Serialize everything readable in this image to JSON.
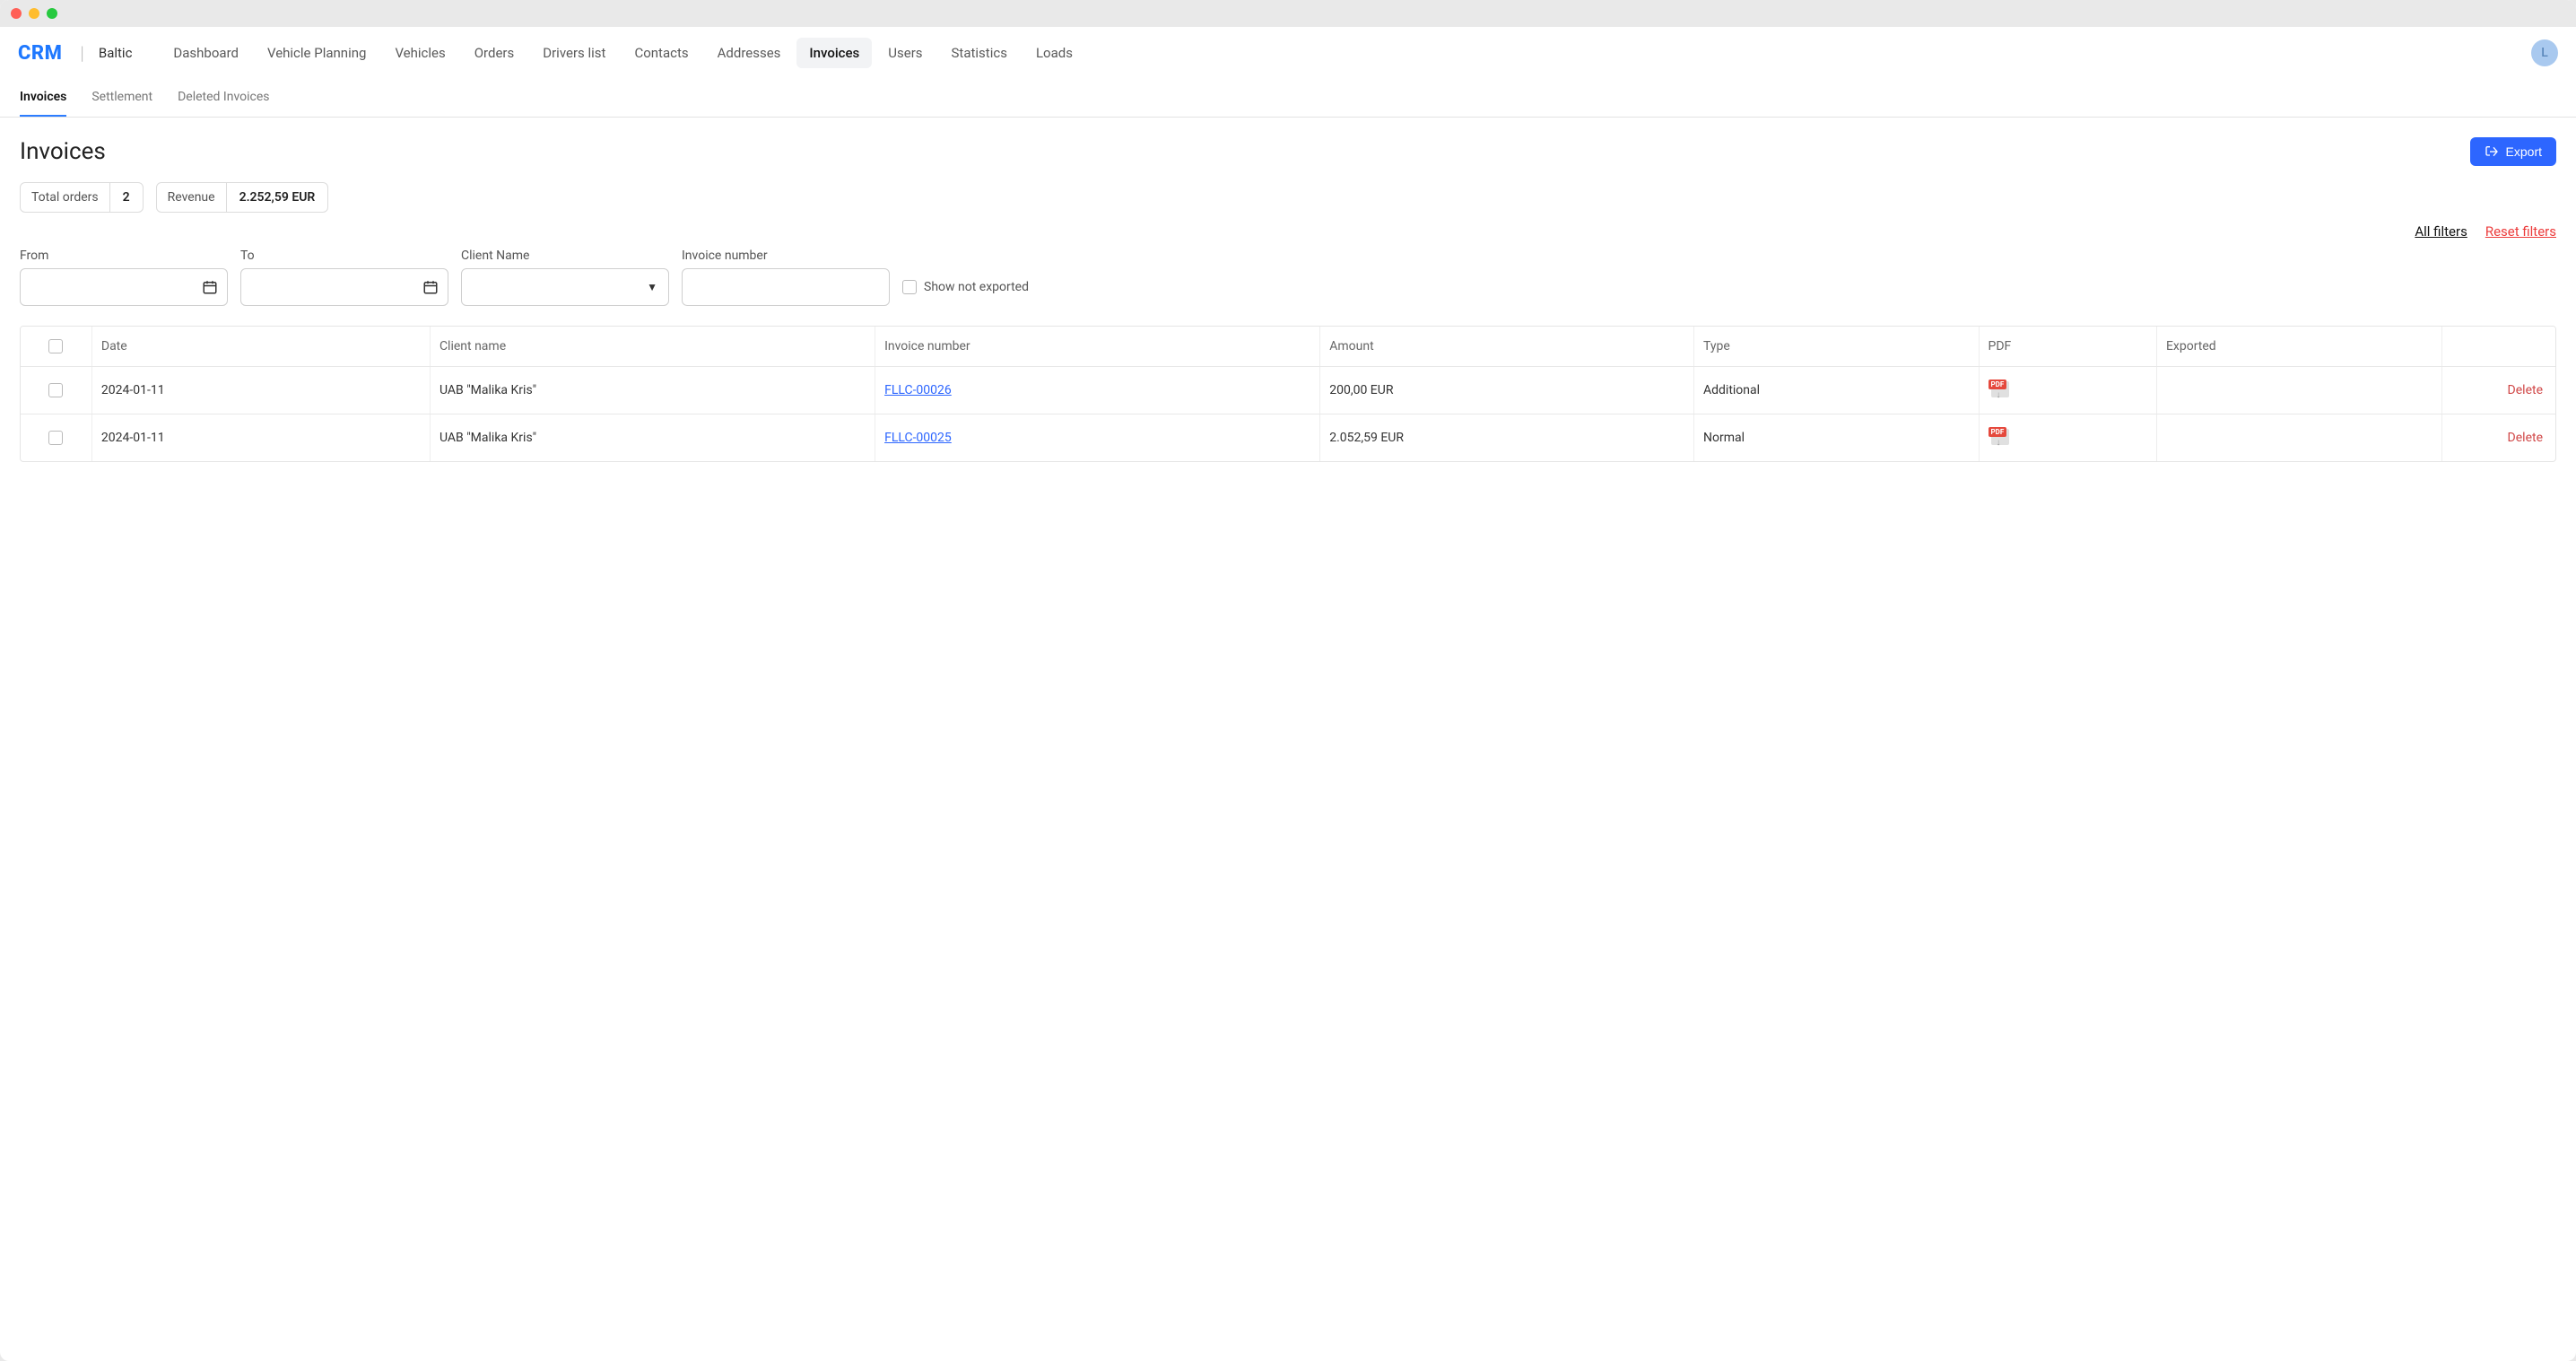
{
  "brand": {
    "logo": "CRM",
    "sub": "Baltic"
  },
  "nav": [
    {
      "label": "Dashboard"
    },
    {
      "label": "Vehicle Planning"
    },
    {
      "label": "Vehicles"
    },
    {
      "label": "Orders"
    },
    {
      "label": "Drivers list"
    },
    {
      "label": "Contacts"
    },
    {
      "label": "Addresses"
    },
    {
      "label": "Invoices",
      "active": true
    },
    {
      "label": "Users"
    },
    {
      "label": "Statistics"
    },
    {
      "label": "Loads"
    }
  ],
  "avatar": "L",
  "subtabs": [
    {
      "label": "Invoices",
      "active": true
    },
    {
      "label": "Settlement"
    },
    {
      "label": "Deleted Invoices"
    }
  ],
  "page": {
    "title": "Invoices",
    "export_label": "Export"
  },
  "stats": {
    "orders_label": "Total orders",
    "orders_value": "2",
    "revenue_label": "Revenue",
    "revenue_value": "2.252,59 EUR"
  },
  "filterlinks": {
    "all": "All filters",
    "reset": "Reset filters"
  },
  "filters": {
    "from_label": "From",
    "to_label": "To",
    "client_label": "Client Name",
    "invnum_label": "Invoice number",
    "show_not_exported": "Show not exported"
  },
  "table": {
    "headers": {
      "date": "Date",
      "client": "Client name",
      "inv": "Invoice number",
      "amount": "Amount",
      "type": "Type",
      "pdf": "PDF",
      "exported": "Exported"
    },
    "rows": [
      {
        "date": "2024-01-11",
        "client": "UAB \"Malika Kris\"",
        "inv": "FLLC-00026",
        "amount": "200,00 EUR",
        "type": "Additional",
        "exported": "",
        "delete": "Delete"
      },
      {
        "date": "2024-01-11",
        "client": "UAB \"Malika Kris\"",
        "inv": "FLLC-00025",
        "amount": "2.052,59 EUR",
        "type": "Normal",
        "exported": "",
        "delete": "Delete"
      }
    ]
  }
}
